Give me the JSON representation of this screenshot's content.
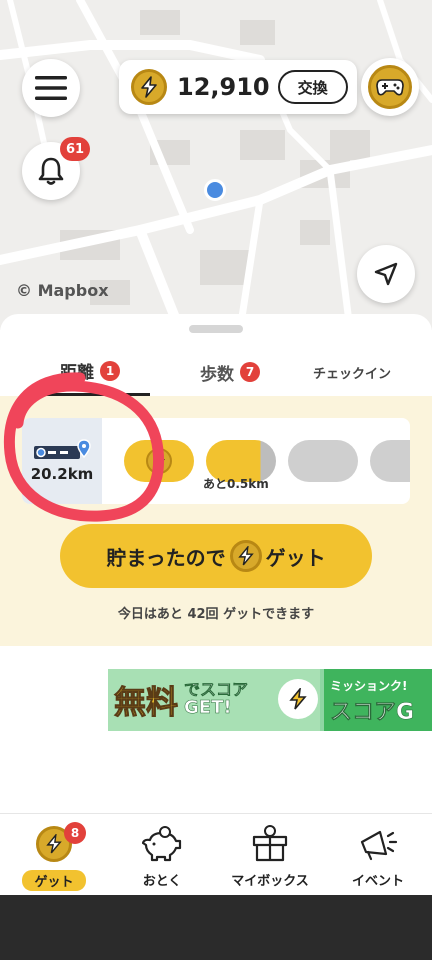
{
  "map": {
    "credit": "© Mapbox"
  },
  "header": {
    "coin_amount": "12,910",
    "exchange_label": "交換",
    "notification_count": "61"
  },
  "tabs": [
    {
      "label": "距離",
      "badge": "1",
      "active": true
    },
    {
      "label": "歩数",
      "badge": "7",
      "active": false
    },
    {
      "label": "チェックイン",
      "active": false
    }
  ],
  "progress": {
    "distance": "20.2km",
    "remaining_label": "あと0.5km",
    "current_step_fill": 0.78
  },
  "get_button": {
    "label_before": "貯まったので",
    "label_after": "ゲット",
    "note": "今日はあと 42回 ゲットできます"
  },
  "banner": {
    "free_text": "無料",
    "score_top": "でスコア",
    "score_bottom": "GET!",
    "right_top": "ミッションク!",
    "right_bottom": "スコアG"
  },
  "bottom_nav": [
    {
      "label": "ゲット",
      "icon": "coin-bolt-icon",
      "badge": "8",
      "active": true
    },
    {
      "label": "おとく",
      "icon": "piggy-bank-icon"
    },
    {
      "label": "マイボックス",
      "icon": "gift-box-icon"
    },
    {
      "label": "イベント",
      "icon": "megaphone-icon"
    }
  ],
  "colors": {
    "accent_yellow": "#f2c22f",
    "badge_red": "#e2413b",
    "panel_cream": "#fbf4dc",
    "user_dot_blue": "#4a8be0",
    "annotation_red": "#f0455a"
  }
}
